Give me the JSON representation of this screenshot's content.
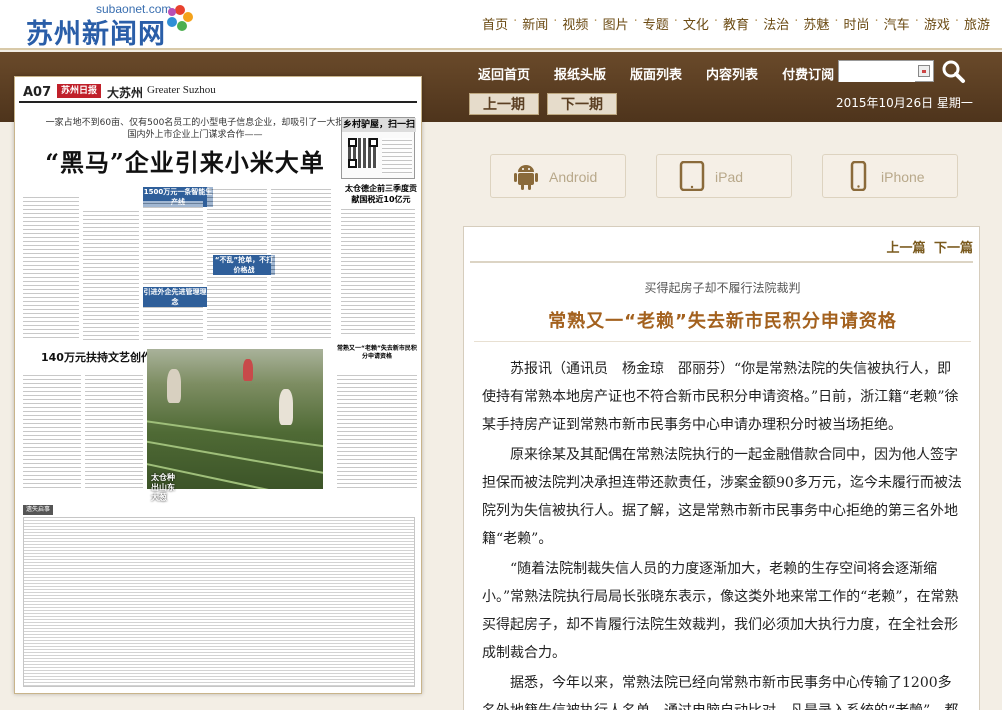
{
  "site": {
    "domain": "subaonet.com",
    "name": "苏州新闻网"
  },
  "top_nav": [
    "首页",
    "新闻",
    "视频",
    "图片",
    "专题",
    "文化",
    "教育",
    "法治",
    "苏魅",
    "时尚",
    "汽车",
    "游戏",
    "旅游"
  ],
  "main_nav": [
    "返回首页",
    "报纸头版",
    "版面列表",
    "内容列表",
    "付费订阅"
  ],
  "search": {
    "value": ""
  },
  "issue_nav": {
    "prev": "上一期",
    "next": "下一期"
  },
  "date": "2015年10月26日  星期一",
  "apps": [
    "Android",
    "iPad",
    "iPhone"
  ],
  "page": {
    "number": "A07",
    "paper_logo": "苏州日报",
    "section": "大苏州",
    "section_en": "Greater Suzhou",
    "sub_headline": "一家占地不到60亩、仅有500名员工的小型电子信息企业，却吸引了一大批国内外上市企业上门谋求合作——",
    "headline": "“黑马”企业引来小米大单",
    "scan_box_title": "乡村驴屋，扫一扫",
    "side_headline": "太仓德企前三季度贡献国税近10亿元",
    "tag1": "1500万元一条智能生产线",
    "tag2": "“不乱”抢单，不打价格战",
    "tag3": "引进外企先进管理理念",
    "feature_headline": "140万元扶持文艺创作",
    "photo_caption": "太仓种出山东大葱",
    "side_box": "常熟又一“老赖”失去新市民积分申请资格",
    "notice_label": "遗失启事"
  },
  "article": {
    "prev": "上一篇",
    "next": "下一篇",
    "pre_title": "买得起房子却不履行法院裁判",
    "title": "常熟又一“老赖”失去新市民积分申请资格",
    "paragraphs": [
      "苏报讯（通讯员　杨金琼　邵丽芬）“你是常熟法院的失信被执行人，即使持有常熟本地房产证也不符合新市民积分申请资格。”日前，浙江籍“老赖”徐某手持房产证到常熟市新市民事务中心申请办理积分时被当场拒绝。",
      "原来徐某及其配偶在常熟法院执行的一起金融借款合同中，因为他人签字担保而被法院判决承担连带还款责任，涉案金额90多万元，迄今未履行而被法院列为失信被执行人。据了解，这是常熟市新市民事务中心拒绝的第三名外地籍“老赖”。",
      "“随着法院制裁失信人员的力度逐渐加大，老赖的生存空间将会逐渐缩小。”常熟法院执行局局长张晓东表示，像这类外地来常工作的“老赖”，在常熟买得起房子，却不肯履行法院生效裁判，我们必须加大执行力度，在全社会形成制裁合力。",
      "据悉，今年以来，常熟法院已经向常熟市新市民事务中心传输了1200多名外地籍失信被执行人名单，通过电脑自动比对，凡是录入系统的“老赖”，都"
    ]
  }
}
